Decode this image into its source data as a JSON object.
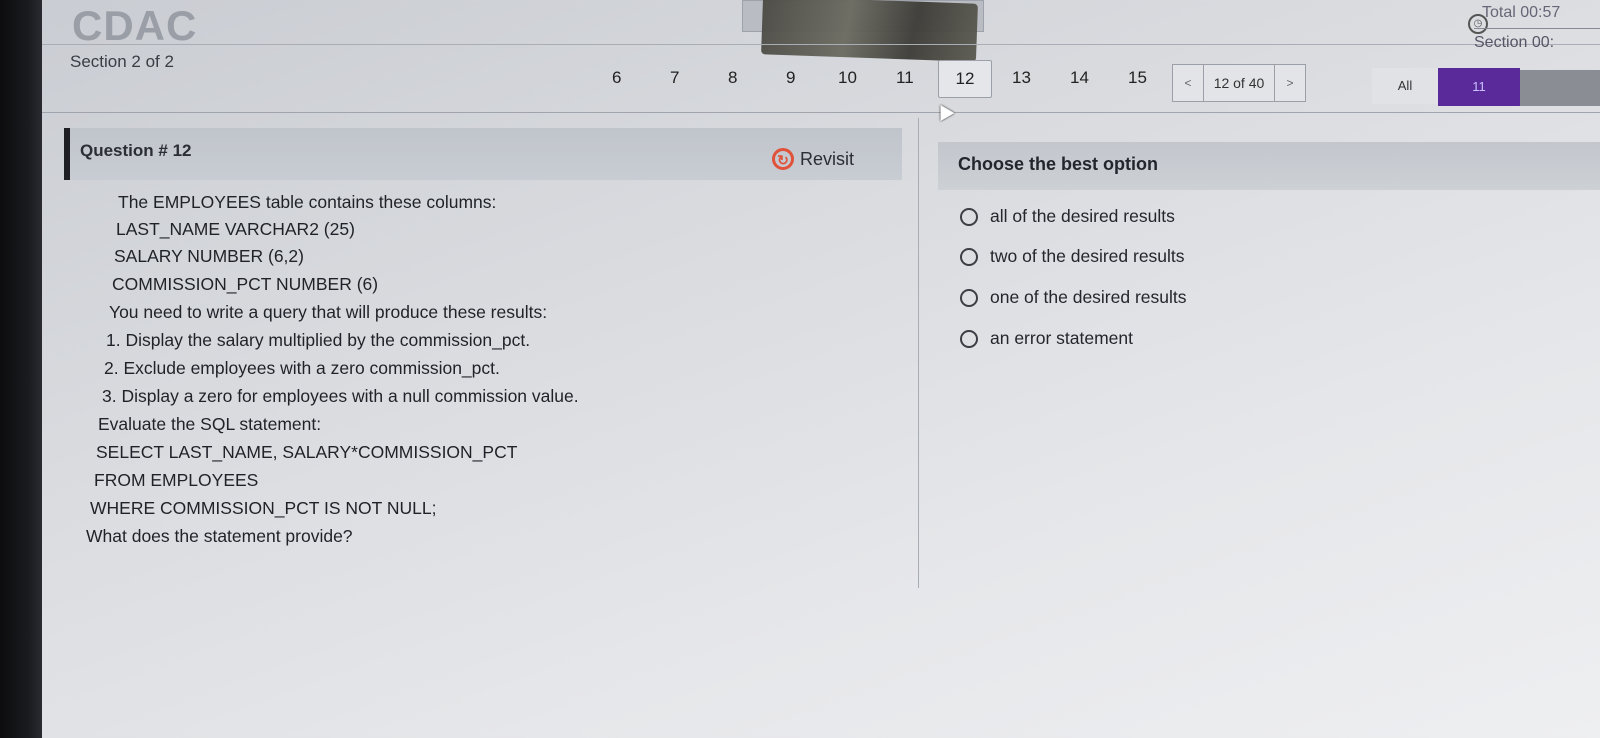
{
  "app": {
    "logo_text": "CDAC",
    "section_label": "Section 2 of 2"
  },
  "timer": {
    "total_label": "Total 00:57",
    "section_label": "Section 00:"
  },
  "nav": {
    "numbers": [
      "6",
      "7",
      "8",
      "9",
      "10",
      "11",
      "12",
      "13",
      "14",
      "15"
    ],
    "current": "12",
    "prev_label": "<",
    "next_label": ">",
    "pager_label": "12 of 40",
    "filter_label": "All",
    "count_label": "11"
  },
  "question": {
    "title": "Question # 12",
    "revisit_label": "Revisit",
    "lines": [
      "The EMPLOYEES table contains these columns:",
      "LAST_NAME VARCHAR2 (25)",
      "SALARY NUMBER (6,2)",
      "COMMISSION_PCT NUMBER (6)",
      "You need to write a query that will produce these results:",
      "1. Display the salary multiplied by the commission_pct.",
      "2. Exclude employees with a zero commission_pct.",
      "3. Display a zero for employees with a null commission value.",
      "Evaluate the SQL statement:",
      "SELECT LAST_NAME, SALARY*COMMISSION_PCT",
      "FROM EMPLOYEES",
      "WHERE COMMISSION_PCT IS NOT NULL;",
      "What does the statement provide?"
    ]
  },
  "options": {
    "title": "Choose the best option",
    "items": [
      "all of the desired results",
      "two of the desired results",
      "one of the desired results",
      "an error statement"
    ]
  },
  "colors": {
    "accent": "#5b2a9a",
    "revisit": "#e0533a"
  }
}
